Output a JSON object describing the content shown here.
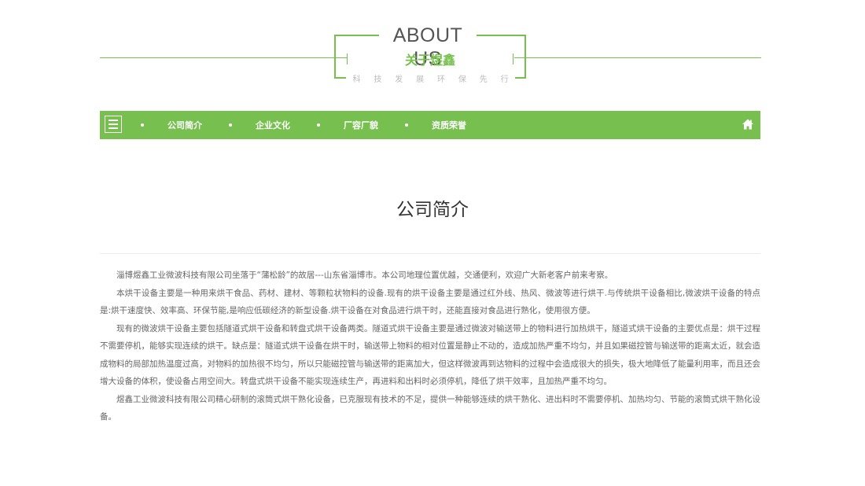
{
  "section": {
    "title_en": "ABOUT US",
    "title_cn": "关于煜鑫",
    "slogan": [
      "科",
      "技",
      "发",
      "展",
      "环",
      "保",
      "先",
      "行"
    ]
  },
  "nav": {
    "items": [
      {
        "label": "公司简介"
      },
      {
        "label": "企业文化"
      },
      {
        "label": "厂容厂貌"
      },
      {
        "label": "资质荣誉"
      }
    ],
    "icons": {
      "menu": "menu-icon",
      "home": "home-icon"
    },
    "accent_color": "#77c04f"
  },
  "page": {
    "heading": "公司简介"
  },
  "article": {
    "paragraphs": [
      "淄博煜鑫工业微波科技有限公司坐落于“蒲松龄”的故居---山东省淄博市。本公司地理位置优越，交通便利，欢迎广大新老客户前来考察。",
      "本烘干设备主要是一种用来烘干食品、药材、建材、等颗粒状物料的设备.现有的烘干设备主要是通过红外线、热风、微波等进行烘干.与传统烘干设备相比,微波烘干设备的特点是:烘干速度快、效率高、环保节能,是响应低碳经济的新型设备.烘干设备在对食品进行烘干时，还能直接对食品进行熟化，使用很方便。",
      "现有的微波烘干设备主要包括隧道式烘干设备和转盘式烘干设备两类。隧道式烘干设备主要是通过微波对输送带上的物料进行加热烘干，隧道式烘干设备的主要优点是：烘干过程不需要停机，能够实现连续的烘干。缺点是：隧道式烘干设备在烘干时，输送带上物料的相对位置是静止不动的，造成加热严重不均匀，并且如果磁控管与输送带的距离太近，就会造成物料的局部加热温度过高，对物料的加热很不均匀，所以只能磁控管与输送带的距离加大，但这样微波再到达物料的过程中会造成很大的损失，极大地降低了能量利用率，而且还会增大设备的体积，使设备占用空间大。转盘式烘干设备不能实现连续生产，再进料和出料时必须停机，降低了烘干效率，且加热严重不均匀。",
      "煜鑫工业微波科技有限公司精心研制的滚筒式烘干熟化设备，已克服现有技术的不足，提供一种能够连续的烘干熟化、进出料时不需要停机、加热均匀、节能的滚筒式烘干熟化设备。"
    ]
  }
}
